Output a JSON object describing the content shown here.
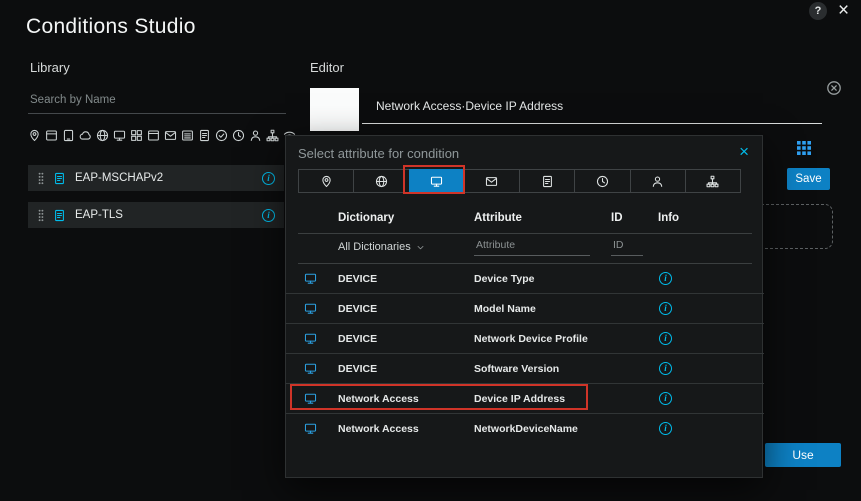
{
  "colors": {
    "accent_teal": "#00bceb",
    "accent_blue": "#0d81c4",
    "highlight_red": "#d03428",
    "background": "#0c0d0e"
  },
  "icons": {
    "info_glyph": "i"
  },
  "header": {
    "title": "Conditions Studio",
    "help_label": "?",
    "close_glyph": "×"
  },
  "library": {
    "title": "Library",
    "search_placeholder": "Search by Name",
    "toolbar_icons": [
      "location",
      "card",
      "tablet",
      "cloud",
      "globe",
      "monitor",
      "grid",
      "window",
      "mail",
      "stack",
      "document",
      "badge",
      "clock",
      "user",
      "sitemap",
      "wifi"
    ],
    "items": [
      {
        "label": "EAP-MSCHAPv2"
      },
      {
        "label": "EAP-TLS"
      }
    ]
  },
  "editor": {
    "title": "Editor",
    "condition_value": "Network Access·Device IP Address",
    "save_label": "Save",
    "use_label": "Use"
  },
  "popup": {
    "title": "Select attribute for condition",
    "close_glyph": "×",
    "tabs": [
      "location",
      "globe",
      "monitor",
      "mail",
      "document",
      "clock",
      "user",
      "sitemap"
    ],
    "selected_tab_index": 2,
    "table": {
      "headers": [
        "Dictionary",
        "Attribute",
        "ID",
        "Info"
      ],
      "filter": {
        "dictionary_label": "All Dictionaries",
        "attribute_placeholder": "Attribute",
        "id_placeholder": "ID"
      },
      "rows": [
        {
          "dictionary": "DEVICE",
          "attribute": "Device Type"
        },
        {
          "dictionary": "DEVICE",
          "attribute": "Model Name"
        },
        {
          "dictionary": "DEVICE",
          "attribute": "Network Device Profile"
        },
        {
          "dictionary": "DEVICE",
          "attribute": "Software Version"
        },
        {
          "dictionary": "Network Access",
          "attribute": "Device IP Address",
          "highlighted": true
        },
        {
          "dictionary": "Network Access",
          "attribute": "NetworkDeviceName"
        }
      ]
    }
  }
}
